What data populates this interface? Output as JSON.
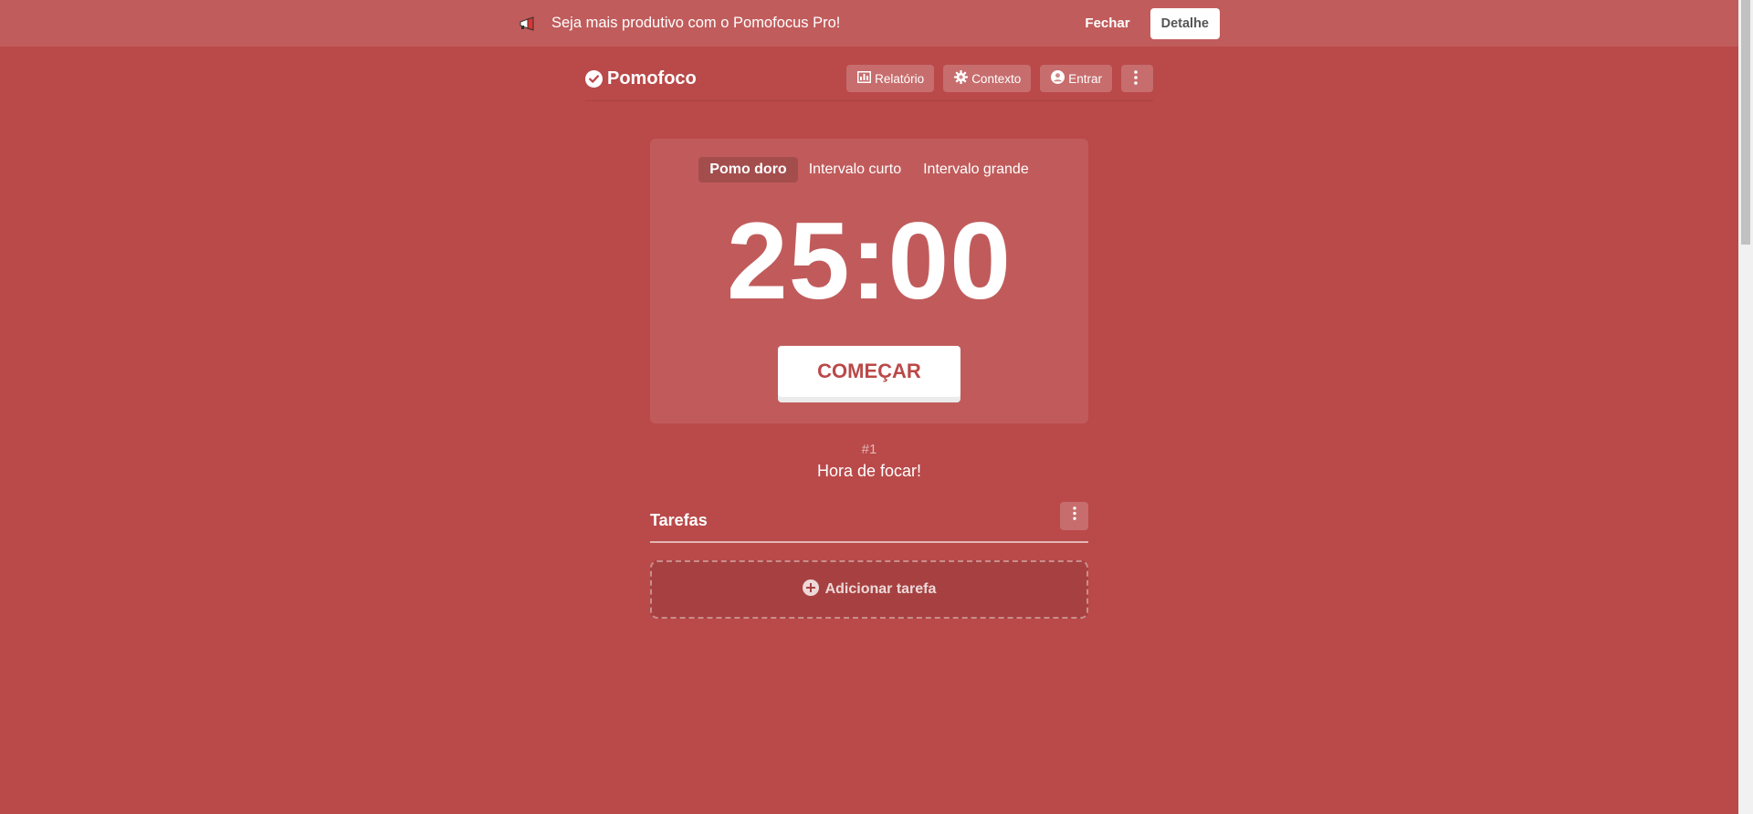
{
  "banner": {
    "icon": "megaphone-icon",
    "text": "Seja mais produtivo com o Pomofocus Pro!",
    "close_label": "Fechar",
    "detail_label": "Detalhe"
  },
  "header": {
    "logo_icon": "check-circle-icon",
    "logo_text": "Pomofoco",
    "nav": [
      {
        "icon": "bar-chart-icon",
        "label": "Relatório"
      },
      {
        "icon": "gear-icon",
        "label": "Contexto"
      },
      {
        "icon": "user-circle-icon",
        "label": "Entrar"
      }
    ],
    "more_icon": "vertical-dots-icon"
  },
  "timer": {
    "modes": [
      {
        "label": "Pomo doro",
        "active": true
      },
      {
        "label": "Intervalo curto",
        "active": false
      },
      {
        "label": "Intervalo grande",
        "active": false
      }
    ],
    "time": "25:00",
    "start_label": "COMEÇAR"
  },
  "status": {
    "session": "#1",
    "message": "Hora de focar!"
  },
  "tasks": {
    "title": "Tarefas",
    "menu_icon": "vertical-dots-icon",
    "add_label": "Adicionar tarefa",
    "add_icon": "plus-circle-icon"
  },
  "colors": {
    "background": "#ba4949",
    "banner": "#c15c5c",
    "accent_text": "#ba4949"
  }
}
